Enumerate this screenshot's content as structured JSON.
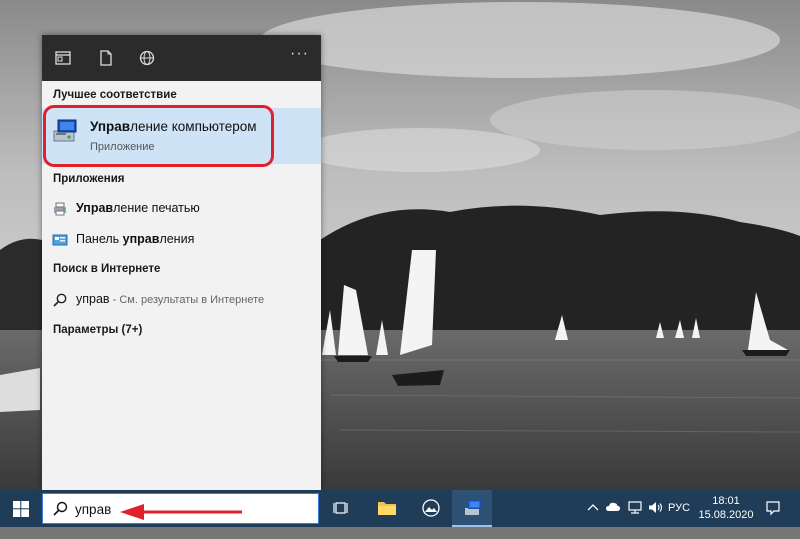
{
  "flyout": {
    "top_icons": [
      "apps-icon",
      "document-icon",
      "web-icon"
    ],
    "more": "···",
    "best_match_heading": "Лучшее соответствие",
    "best_match": {
      "title_bold": "Управ",
      "title_rest": "ление компьютером",
      "subtitle": "Приложение"
    },
    "apps_heading": "Приложения",
    "apps": [
      {
        "bold": "Управ",
        "rest": "ление печатью",
        "pre": ""
      },
      {
        "pre": "Панель ",
        "bold": "управ",
        "rest": "ления"
      }
    ],
    "web_heading": "Поиск в Интернете",
    "web_result": {
      "query": "управ",
      "hint": " - См. результаты в Интернете"
    },
    "settings_heading": "Параметры (7+)"
  },
  "taskbar": {
    "search_value": "управ",
    "tray": {
      "lang": "РУС",
      "time": "18:01",
      "date": "15.08.2020"
    }
  },
  "colors": {
    "accent": "#e0202a",
    "highlight": "#cfe3f7",
    "taskbar": "#1f3d58"
  }
}
